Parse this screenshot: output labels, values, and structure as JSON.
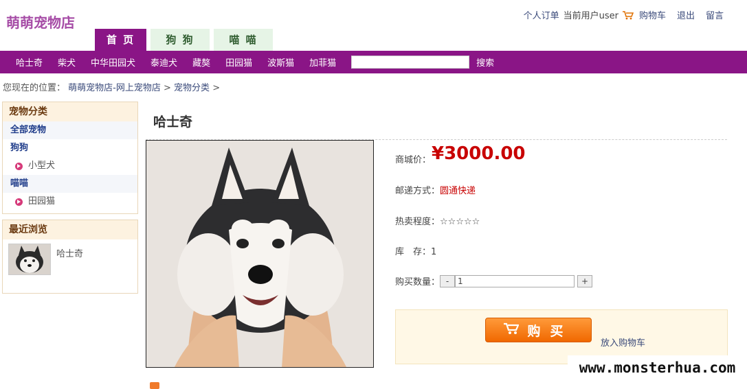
{
  "header": {
    "logo": "萌萌宠物店",
    "links": {
      "orders": "个人订单",
      "user": "当前用户user",
      "cart": "购物车",
      "logout": "退出",
      "message": "留言"
    }
  },
  "tabs": [
    {
      "label": "首 页",
      "active": true
    },
    {
      "label": "狗 狗",
      "active": false
    },
    {
      "label": "喵 喵",
      "active": false
    }
  ],
  "nav": {
    "items": [
      "哈士奇",
      "柴犬",
      "中华田园犬",
      "泰迪犬",
      "藏獒",
      "田园猫",
      "波斯猫",
      "加菲猫"
    ],
    "search_button": "搜索"
  },
  "breadcrumb": {
    "prefix": "您现在的位置：",
    "store": "萌萌宠物店-网上宠物店",
    "sep": ">",
    "category": "宠物分类",
    "tail": ">"
  },
  "sidebar": {
    "category_title": "宠物分类",
    "all": "全部宠物",
    "dog": "狗狗",
    "dog_sub": "小型犬",
    "cat": "喵喵",
    "cat_sub": "田园猫",
    "recent_title": "最近浏览",
    "recent_item": "哈士奇"
  },
  "product": {
    "name": "哈士奇",
    "price_label": "商城价：",
    "price": "¥3000.00",
    "ship_label": "邮递方式：",
    "ship_value": "圆通快递",
    "hot_label": "热卖程度：",
    "hot_value": "☆☆☆☆☆",
    "stock_label": "库　存：",
    "stock_value": "1",
    "qty_label": "购买数量：",
    "qty_minus": "-",
    "qty_value": "1",
    "qty_plus": "+",
    "buy_label": "购买",
    "add_cart": "放入购物车"
  },
  "watermark": "www.monsterhua.com",
  "colors": {
    "brand": "#8a1586",
    "price": "#c80000",
    "buy": "#f06800"
  }
}
